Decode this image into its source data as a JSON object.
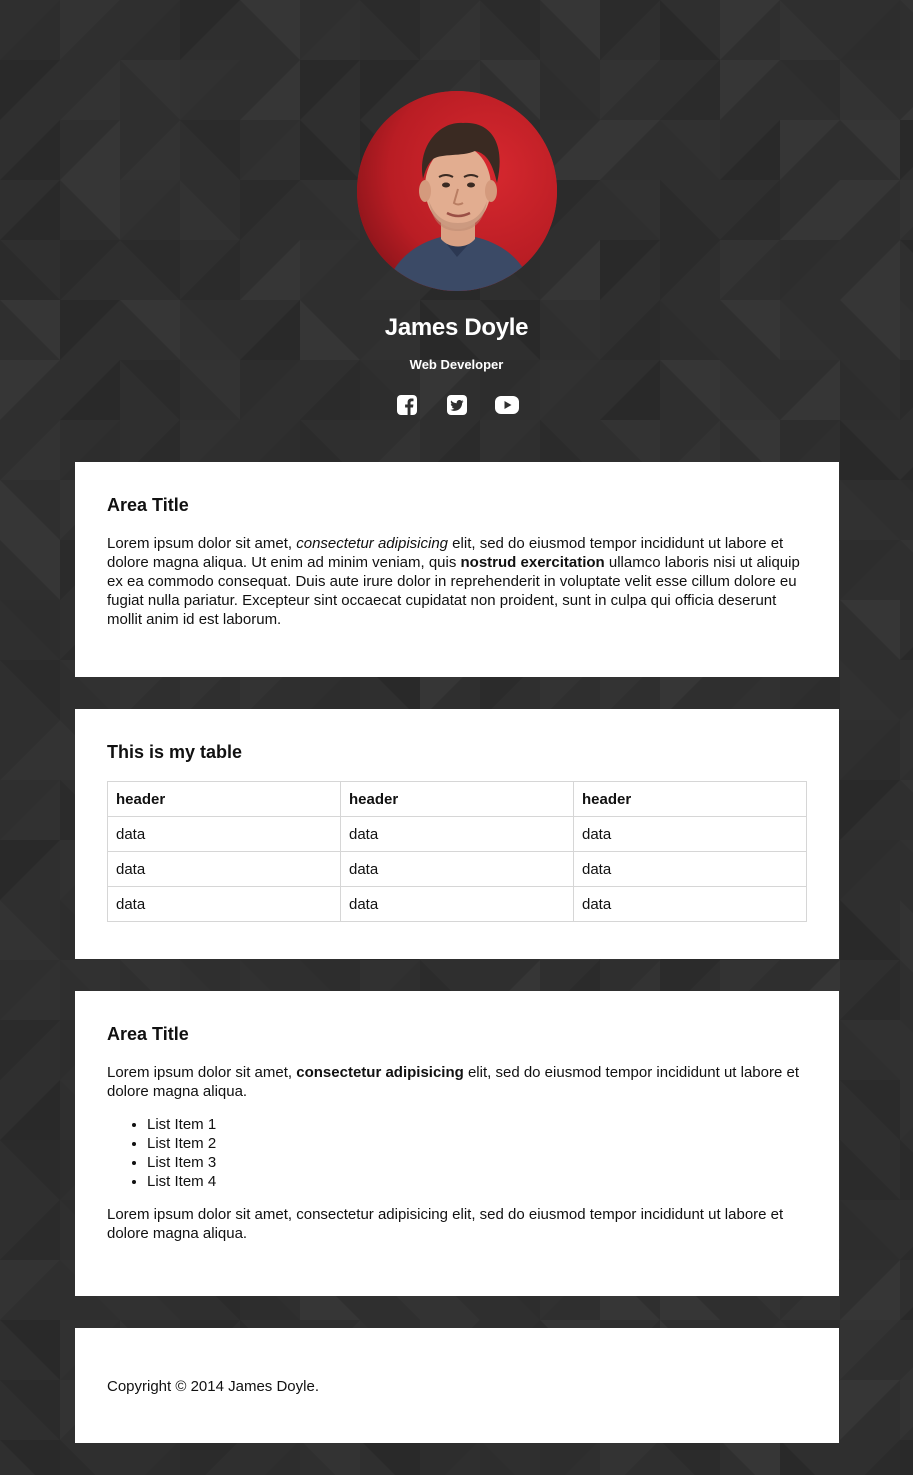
{
  "profile": {
    "name": "James Doyle",
    "role": "Web Developer",
    "avatar_bg_color": "#c4202a",
    "social": [
      {
        "icon": "facebook-icon",
        "label": "Facebook"
      },
      {
        "icon": "twitter-icon",
        "label": "Twitter"
      },
      {
        "icon": "youtube-icon",
        "label": "YouTube"
      }
    ]
  },
  "section1": {
    "title": "Area Title",
    "text_before_italic": "Lorem ipsum dolor sit amet, ",
    "italic": "consectetur adipisicing",
    "text_after_italic": " elit, sed do eiusmod tempor incididunt ut labore et dolore magna aliqua. Ut enim ad minim veniam, quis ",
    "bold": "nostrud exercitation",
    "text_after_bold": " ullamco laboris nisi ut aliquip ex ea commodo consequat. Duis aute irure dolor in reprehenderit in voluptate velit esse cillum dolore eu fugiat nulla pariatur. Excepteur sint occaecat cupidatat non proident, sunt in culpa qui officia deserunt mollit anim id est laborum."
  },
  "section2": {
    "title": "This is my table",
    "table": {
      "headers": [
        "header",
        "header",
        "header"
      ],
      "rows": [
        [
          "data",
          "data",
          "data"
        ],
        [
          "data",
          "data",
          "data"
        ],
        [
          "data",
          "data",
          "data"
        ]
      ]
    }
  },
  "section3": {
    "title": "Area Title",
    "text_before_bold": "Lorem ipsum dolor sit amet, ",
    "bold": "consectetur adipisicing",
    "text_after_bold": " elit, sed do eiusmod tempor incididunt ut labore et dolore magna aliqua.",
    "list": [
      "List Item 1",
      "List Item 2",
      "List Item 3",
      "List Item 4"
    ],
    "closing": "Lorem ipsum dolor sit amet, consectetur adipisicing elit, sed do eiusmod tempor incididunt ut labore et dolore magna aliqua."
  },
  "footer": {
    "copyright": "Copyright © 2014 James Doyle."
  },
  "colors": {
    "background": "#2f2f2f",
    "card": "#ffffff",
    "text": "#111111"
  }
}
